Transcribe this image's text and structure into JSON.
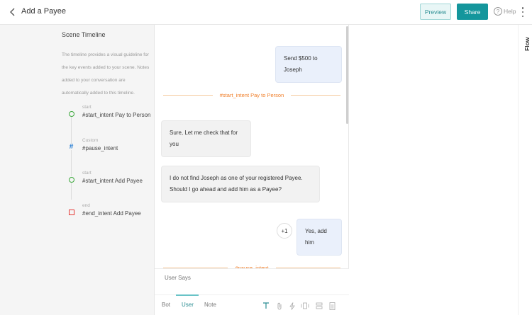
{
  "header": {
    "title": "Add a Payee",
    "preview_label": "Preview",
    "share_label": "Share",
    "help_label": "Help",
    "help_glyph": "?"
  },
  "timeline": {
    "heading": "Scene Timeline",
    "description": "The timeline provides a visual guideline for the key events added to your scene. Notes added to your conversation are automatically added to this timeline.",
    "items": [
      {
        "type": "start",
        "label": "#start_intent Pay to Person",
        "marker": "start"
      },
      {
        "type": "Custom",
        "label": "#pause_intent",
        "marker": "custom"
      },
      {
        "type": "start",
        "label": "#start_intent Add Payee",
        "marker": "start"
      },
      {
        "type": "end",
        "label": "#end_intent Add Payee",
        "marker": "end"
      }
    ]
  },
  "chat": {
    "messages": [
      {
        "from": "user",
        "text": "Send $500 to Joseph"
      },
      {
        "divider": "#start_intent Pay to Person"
      },
      {
        "from": "bot",
        "text": "Sure, Let me check that for you"
      },
      {
        "from": "bot",
        "text": "I do not find Joseph as one of your registered Payee. Should I go ahead and add him as a Payee?"
      },
      {
        "from": "user",
        "text": "Yes, add him",
        "badge": "+1"
      },
      {
        "divider": "#pause_intent"
      }
    ],
    "composer_placeholder": "User Says",
    "tabs": [
      "Bot",
      "User",
      "Note"
    ],
    "active_tab": "User"
  },
  "side_panel": {
    "flow_label": "Flow"
  },
  "colors": {
    "accent": "#14969c",
    "intent_divider": "#f07f2a",
    "start_marker": "#3ca83c",
    "custom_marker": "#2a7fd4",
    "end_marker": "#e53935"
  }
}
